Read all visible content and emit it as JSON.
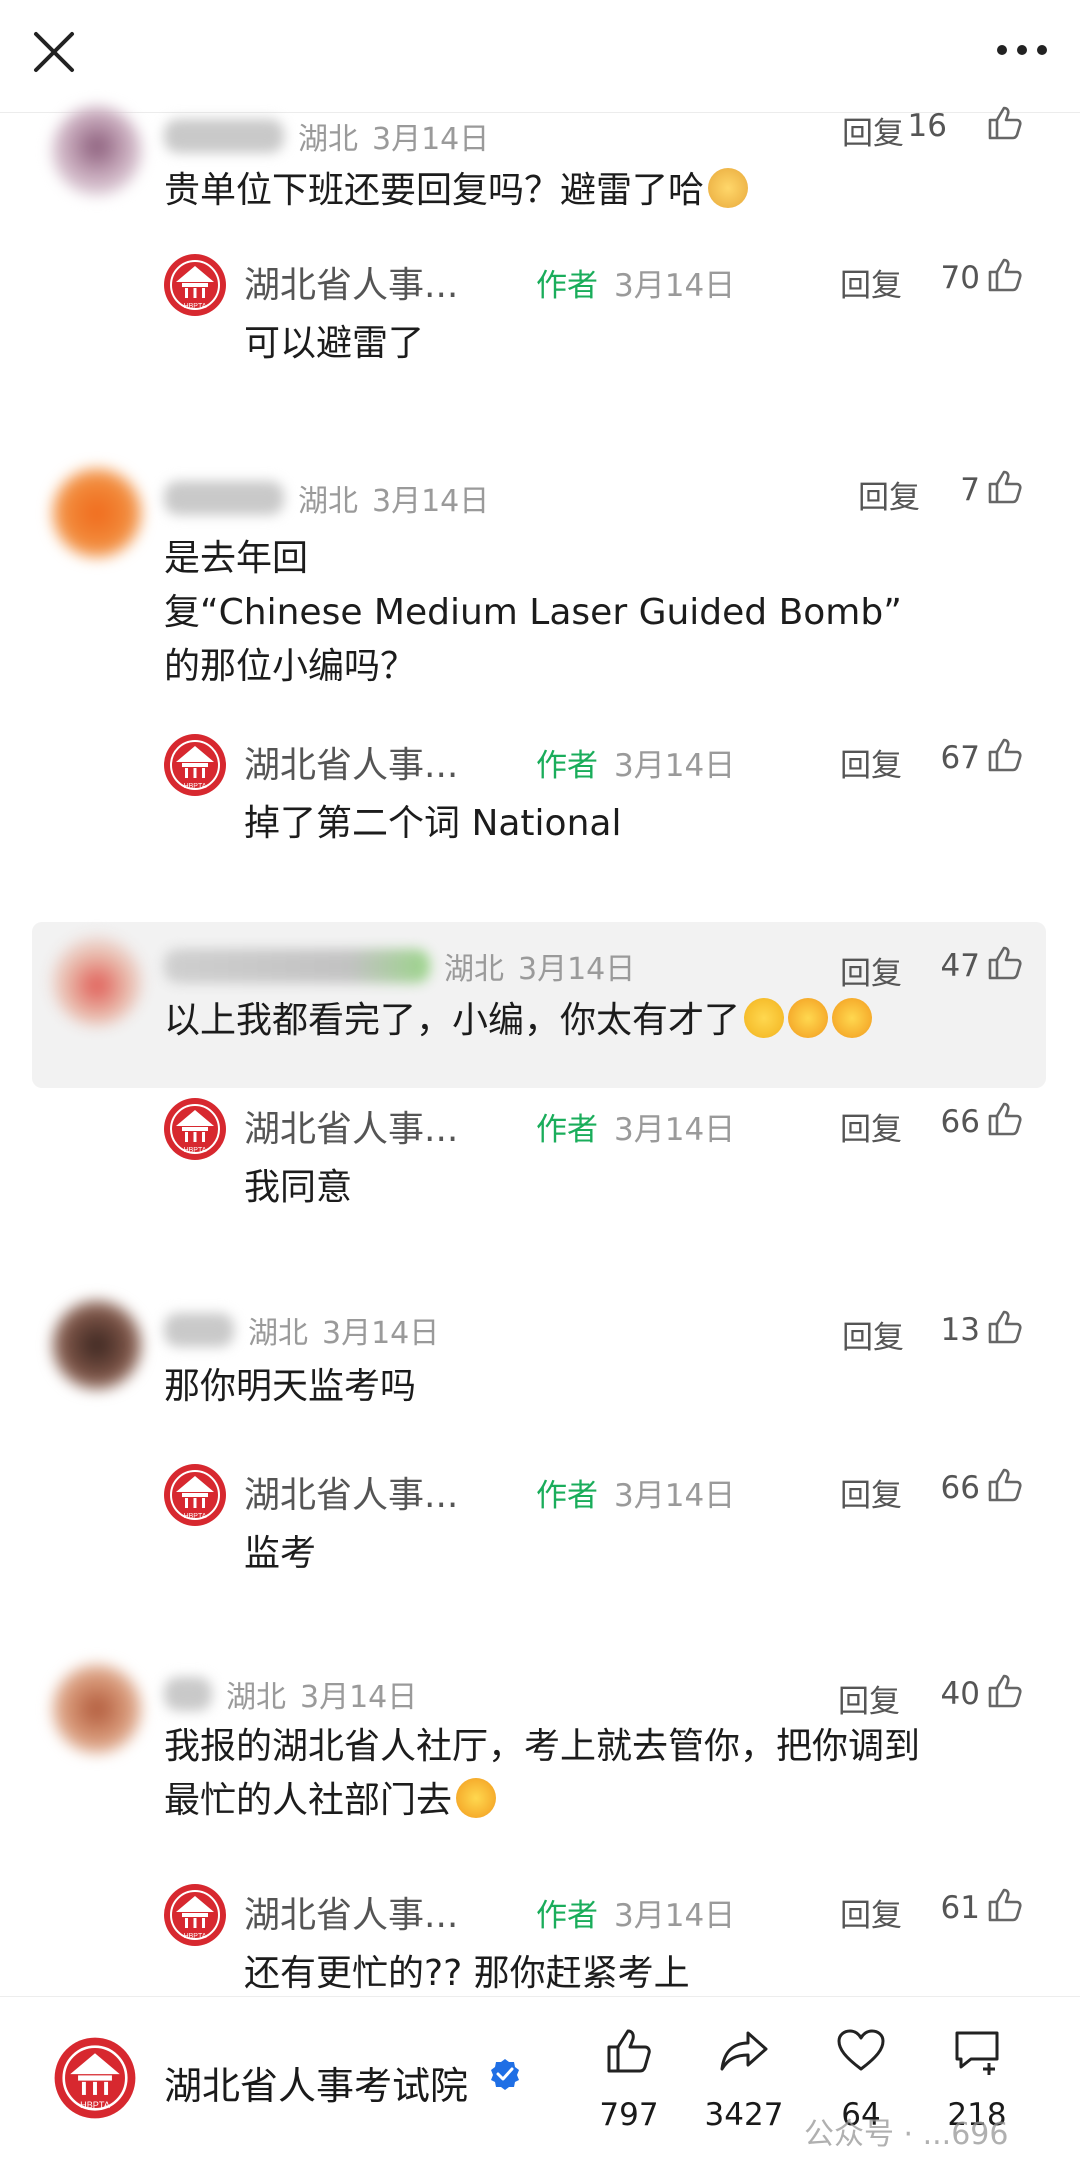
{
  "comments": [
    {
      "location": "湖北",
      "date": "3月14日",
      "text": "贵单位下班还要回复吗？避雷了哈",
      "reply_label": "回复",
      "likes": "16",
      "author_reply": {
        "name": "湖北省人事...",
        "tag": "作者",
        "date": "3月14日",
        "text": "可以避雷了",
        "reply_label": "回复",
        "likes": "70"
      }
    },
    {
      "location": "湖北",
      "date": "3月14日",
      "text_lines": [
        "是去年回",
        "复“Chinese Medium  Laser  Guided Bomb”",
        "的那位小编吗？"
      ],
      "reply_label": "回复",
      "likes": "7",
      "author_reply": {
        "name": "湖北省人事...",
        "tag": "作者",
        "date": "3月14日",
        "text": "掉了第二个词 National",
        "reply_label": "回复",
        "likes": "67"
      }
    },
    {
      "location": "湖北",
      "date": "3月14日",
      "text": "以上我都看完了，小编，你太有才了",
      "reply_label": "回复",
      "likes": "47",
      "author_reply": {
        "name": "湖北省人事...",
        "tag": "作者",
        "date": "3月14日",
        "text": "我同意",
        "reply_label": "回复",
        "likes": "66"
      }
    },
    {
      "location": "湖北",
      "date": "3月14日",
      "text": "那你明天监考吗",
      "reply_label": "回复",
      "likes": "13",
      "author_reply": {
        "name": "湖北省人事...",
        "tag": "作者",
        "date": "3月14日",
        "text": "监考",
        "reply_label": "回复",
        "likes": "66"
      }
    },
    {
      "location": "湖北",
      "date": "3月14日",
      "text_lines": [
        "我报的湖北省人社厅，考上就去管你，把你调到",
        "最忙的人社部门去"
      ],
      "reply_label": "回复",
      "likes": "40",
      "author_reply": {
        "name": "湖北省人事...",
        "tag": "作者",
        "date": "3月14日",
        "text": "还有更忙的?? 那你赶紧考上",
        "reply_label": "回复",
        "likes": "61"
      }
    }
  ],
  "footer": {
    "account_name": "湖北省人事考试院",
    "logo_text": "HBPTA",
    "like_count": "797",
    "share_count": "3427",
    "favorite_count": "64",
    "comment_count": "218",
    "watermark": "公众号 · ...696"
  },
  "colors": {
    "author_tag": "#1aad5b",
    "logo_red": "#d7282f",
    "verified_blue": "#1f6fe5"
  },
  "icons": [
    "close-icon",
    "more-icon",
    "thumbs-up-icon",
    "share-icon",
    "heart-icon",
    "comment-add-icon",
    "verified-icon"
  ]
}
